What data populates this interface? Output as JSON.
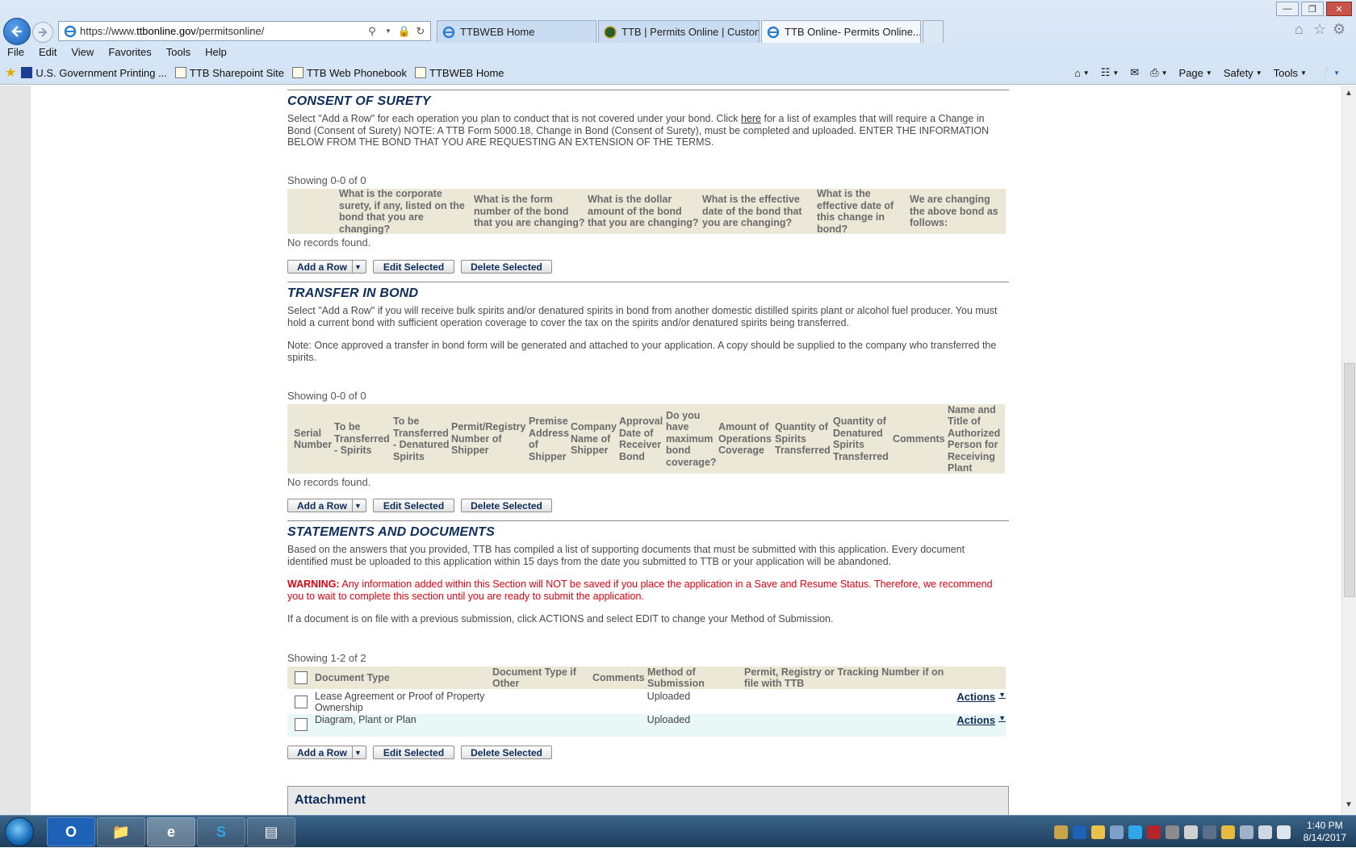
{
  "browser": {
    "url_prefix": "https://www.",
    "url_domain": "ttbonline.gov",
    "url_path": "/permitsonline/",
    "tabs": [
      {
        "label": "TTBWEB Home"
      },
      {
        "label": "TTB | Permits Online | Custom..."
      },
      {
        "label": "TTB Online- Permits Online..."
      }
    ],
    "menu": [
      "File",
      "Edit",
      "View",
      "Favorites",
      "Tools",
      "Help"
    ],
    "favorites": [
      {
        "label": "U.S. Government Printing ..."
      },
      {
        "label": "TTB Sharepoint Site"
      },
      {
        "label": "TTB Web Phonebook"
      },
      {
        "label": "TTBWEB Home"
      }
    ],
    "commands": {
      "page": "Page",
      "safety": "Safety",
      "tools": "Tools"
    }
  },
  "consent": {
    "title": "CONSENT OF SURETY",
    "desc_before_link": "Select \"Add a Row\" for each operation you plan to conduct that is not covered under your bond. Click ",
    "link": "here",
    "desc_after_link": " for a list of examples that will require a Change in Bond (Consent of Surety) NOTE: A TTB Form 5000.18, Change in Bond (Consent of Surety), must be completed and uploaded. ENTER THE INFORMATION BELOW FROM THE BOND THAT YOU ARE REQUESTING AN EXTENSION OF THE TERMS.",
    "showing": "Showing 0-0 of 0",
    "columns": [
      "What is the corporate surety, if any, listed on the bond that you are changing?",
      "What is the form number of the bond that you are changing?",
      "What is the dollar amount of the bond that you are changing?",
      "What is the effective date of the bond that you are changing?",
      "What is the effective date of this change in bond?",
      "We are changing the above bond as follows:"
    ],
    "no_records": "No records found."
  },
  "transfer": {
    "title": "TRANSFER IN BOND",
    "desc": "Select \"Add a Row\" if you will receive bulk spirits and/or denatured spirits in bond from another domestic distilled spirits plant or alcohol fuel producer. You must hold a current bond with sufficient operation coverage to cover the tax on the spirits and/or denatured spirits being transferred.",
    "note": "Note: Once approved a transfer in bond form will be generated and attached to your application. A copy should be supplied to the company who transferred the spirits.",
    "showing": "Showing 0-0 of 0",
    "columns": [
      "Serial Number",
      "To be Transferred - Spirits",
      "To be Transferred - Denatured Spirits",
      "Permit/Registry Number of Shipper",
      "Premise Address of Shipper",
      "Company Name of Shipper",
      "Approval Date of Receiver Bond",
      "Do you have maximum bond coverage?",
      "Amount of Operations Coverage",
      "Quantity of Spirits Transferred",
      "Quantity of Denatured Spirits Transferred",
      "Comments",
      "Name and Title of Authorized Person for Receiving Plant"
    ],
    "no_records": "No records found."
  },
  "statements": {
    "title": "STATEMENTS AND DOCUMENTS",
    "desc": "Based on the answers that you provided, TTB has compiled a list of supporting documents that must be submitted with this application. Every document identified must be uploaded to this application within 15 days from the date you submitted to TTB or your application will be abandoned.",
    "warning_label": "WARNING:",
    "warning_text": " Any information added within this Section will NOT be saved if you place the application in a Save and Resume Status. Therefore, we recommend you to wait to complete this section until you are ready to submit the application.",
    "info": "If a document is on file with a previous submission, click ACTIONS and select EDIT to change your Method of Submission.",
    "showing": "Showing 1-2 of 2",
    "columns": {
      "doc_type": "Document Type",
      "doc_type_other": "Document Type if Other",
      "comments": "Comments",
      "method": "Method of Submission",
      "permit": "Permit, Registry or Tracking Number if on file with TTB"
    },
    "rows": [
      {
        "doc_type": "Lease Agreement or Proof of Property Ownership",
        "method": "Uploaded",
        "actions": "Actions"
      },
      {
        "doc_type": "Diagram, Plant or Plan",
        "method": "Uploaded",
        "actions": "Actions"
      }
    ]
  },
  "buttons": {
    "add_row": "Add a Row",
    "edit_selected": "Edit Selected",
    "delete_selected": "Delete Selected"
  },
  "attachment": {
    "title": "Attachment"
  },
  "taskbar": {
    "time": "1:40 PM",
    "date": "8/14/2017"
  },
  "colors": {
    "title_blue": "#0d2d5c",
    "header_beige": "#ebe8d8",
    "warning_red": "#e3000f",
    "row_alt": "#e9f7f7"
  }
}
